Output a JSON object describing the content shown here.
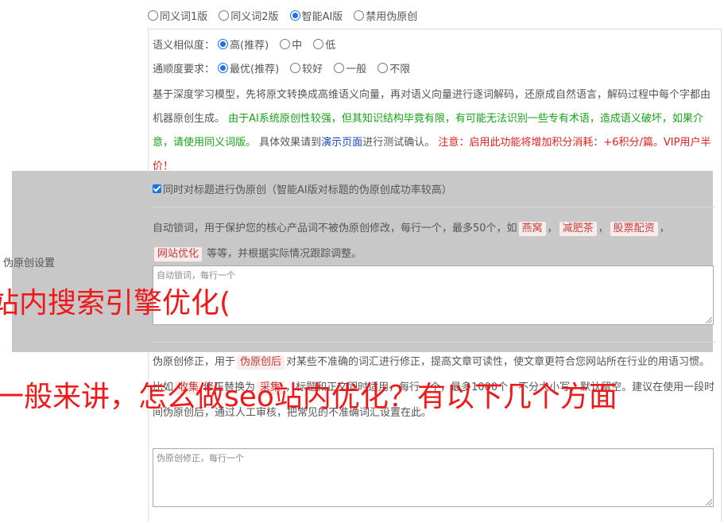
{
  "modes": [
    {
      "label": "同义词1版",
      "checked": false
    },
    {
      "label": "同义词2版",
      "checked": false
    },
    {
      "label": "智能AI版",
      "checked": true
    },
    {
      "label": "禁用伪原创",
      "checked": false
    }
  ],
  "similarity": {
    "label": "语义相似度：",
    "options": [
      {
        "label": "高(推荐)",
        "checked": true
      },
      {
        "label": "中",
        "checked": false
      },
      {
        "label": "低",
        "checked": false
      }
    ]
  },
  "fluency": {
    "label": "通顺度要求：",
    "options": [
      {
        "label": "最优(推荐)",
        "checked": true
      },
      {
        "label": "较好",
        "checked": false
      },
      {
        "label": "一般",
        "checked": false
      },
      {
        "label": "不限",
        "checked": false
      }
    ]
  },
  "description": {
    "part1": "基于深度学习模型，先将原文转换成高维语义向量，再对语义向量进行逐词解码，还原成自然语言，解码过程中每个字都由机器原创生成。",
    "warning_green": "由于AI系统原创性较强，但其知识结构毕竟有限，有可能无法识别一些专有术语，造成语义破坏，如果介意，请使用同义词版。",
    "part2": "具体效果请到",
    "demo_link": "演示页面",
    "part3": "进行测试确认。",
    "notice_red": "注意：启用此功能将增加积分消耗：+6积分/篇。VIP用户半价！"
  },
  "title_checkbox": {
    "label": "同时对标题进行伪原创（智能AI版对标题的伪原创成功率较高）",
    "checked": true
  },
  "lock_words": {
    "intro": "自动锁词，用于保护您的核心产品词不被伪原创修改，每行一个，最多50个，如",
    "examples": [
      "燕窝",
      "减肥茶",
      "股票配资",
      "网站优化"
    ],
    "outro": "等等，并根据实际情况跟踪调整。",
    "placeholder": "自动锁词，每行一个"
  },
  "side_label": "伪原创设置",
  "overlay_text_1": "站内搜索引擎优化(",
  "overlay_text_2": "一般来讲，怎么做seo站内优化？有以下几个方面",
  "fix": {
    "intro": "伪原创修正，用于",
    "tag": "伪原创后",
    "text1": "对某些不准确的词汇进行修正，提高文章可读性，使文章更符合您网站所在行业的用语习惯。比如",
    "tag2": "收集",
    "text2": "修正替换为",
    "tag3": "采集",
    "text3": "，标题和正文同时适用，每行一个，最多1000个，不分大小写，默认留空。建议在使用一段时间伪原创后，通过人工审核，把常见的不准确词汇设置在此。",
    "placeholder": "伪原创修正，每行一个"
  }
}
